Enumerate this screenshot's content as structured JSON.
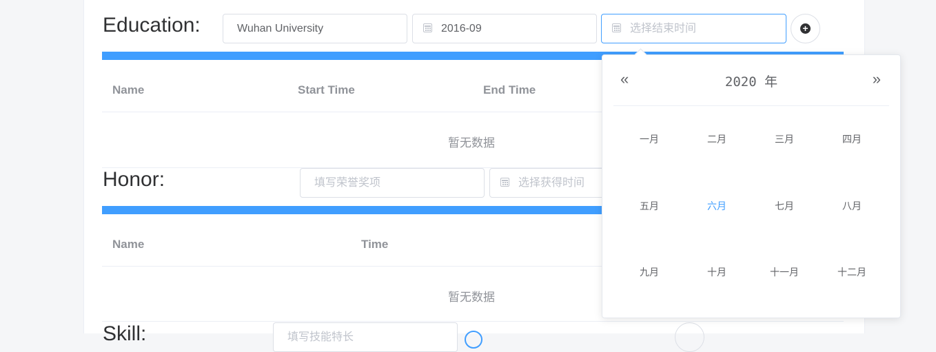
{
  "education": {
    "title": "Education:",
    "school_value": "Wuhan University",
    "start_value": "2016-09",
    "end_placeholder": "选择结束时间",
    "table_headers": [
      "Name",
      "Start Time",
      "End Time"
    ],
    "empty_text": "暂无数据"
  },
  "honor": {
    "title": "Honor:",
    "award_placeholder": "填写荣誉奖项",
    "time_placeholder": "选择获得时间",
    "table_headers": [
      "Name",
      "Time"
    ],
    "empty_text": "暂无数据"
  },
  "skill": {
    "title": "Skill:",
    "input_placeholder": "填写技能特长"
  },
  "month_picker": {
    "prev_year": "«",
    "next_year": "»",
    "year_label": "2020 年",
    "months": [
      "一月",
      "二月",
      "三月",
      "四月",
      "五月",
      "六月",
      "七月",
      "八月",
      "九月",
      "十月",
      "十一月",
      "十二月"
    ],
    "current_month_index": 5
  },
  "colors": {
    "accent": "#409eff",
    "border": "#dcdfe6",
    "header_text": "#909399"
  }
}
